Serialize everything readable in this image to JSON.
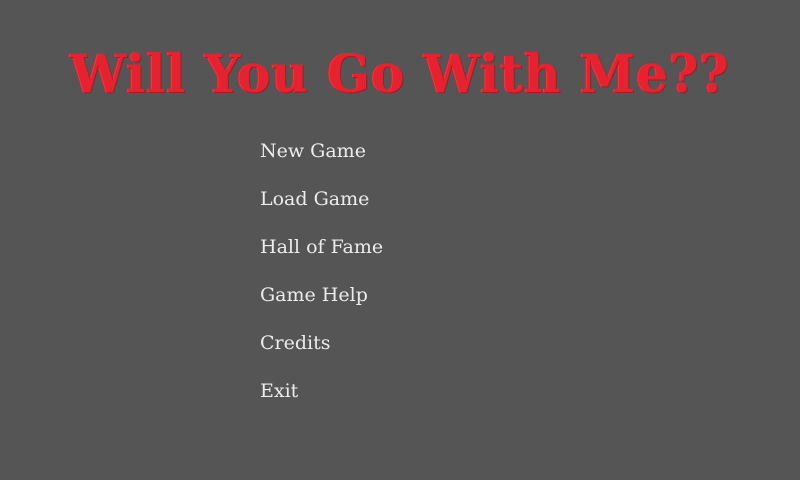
{
  "game_title": "Will You Go With Me??",
  "menu": {
    "items": [
      {
        "label": "New Game"
      },
      {
        "label": "Load Game"
      },
      {
        "label": "Hall of Fame"
      },
      {
        "label": "Game Help"
      },
      {
        "label": "Credits"
      },
      {
        "label": "Exit"
      }
    ]
  },
  "colors": {
    "background": "#555555",
    "title": "#e8212e",
    "menu_text": "#ececec"
  }
}
